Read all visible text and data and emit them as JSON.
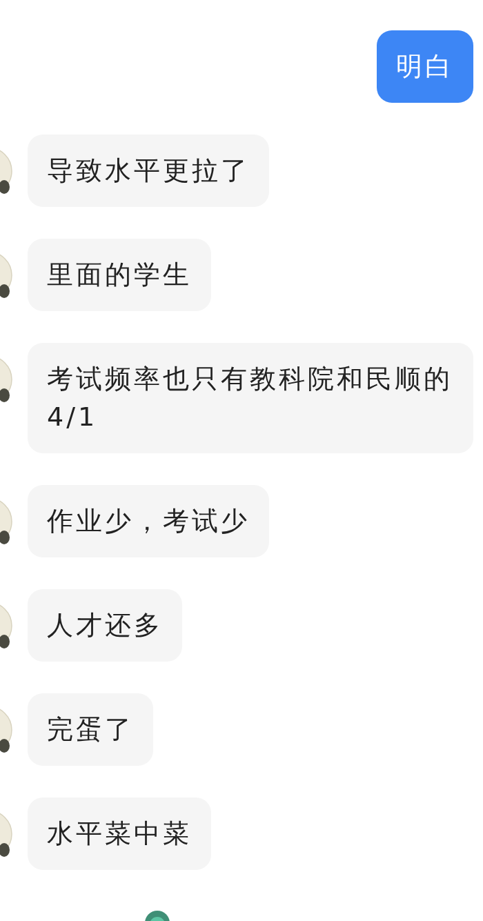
{
  "messages": [
    {
      "kind": "sent",
      "text": "明白"
    },
    {
      "kind": "received",
      "text": "导致水平更拉了"
    },
    {
      "kind": "received",
      "text": "里面的学生"
    },
    {
      "kind": "received",
      "text": "考试频率也只有教科院和民顺的4/1"
    },
    {
      "kind": "received",
      "text": "作业少，考试少"
    },
    {
      "kind": "received",
      "text": "人才还多"
    },
    {
      "kind": "received",
      "text": "完蛋了"
    },
    {
      "kind": "received",
      "text": "水平菜中菜"
    }
  ]
}
